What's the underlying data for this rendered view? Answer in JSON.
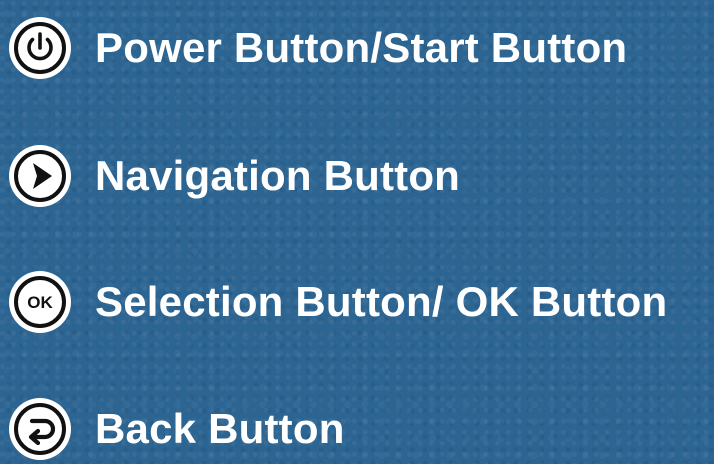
{
  "buttons": [
    {
      "label": "Power Button/Start Button",
      "icon": "power-icon"
    },
    {
      "label": "Navigation Button",
      "icon": "play-arrow-icon"
    },
    {
      "label": "Selection Button/ OK Button",
      "icon": "ok-icon",
      "icon_text": "OK"
    },
    {
      "label": "Back Button",
      "icon": "back-arrow-icon"
    }
  ],
  "colors": {
    "background": "#2c6492",
    "icon_ring": "#ffffff",
    "icon_fill": "#111111",
    "text": "#ffffff"
  }
}
